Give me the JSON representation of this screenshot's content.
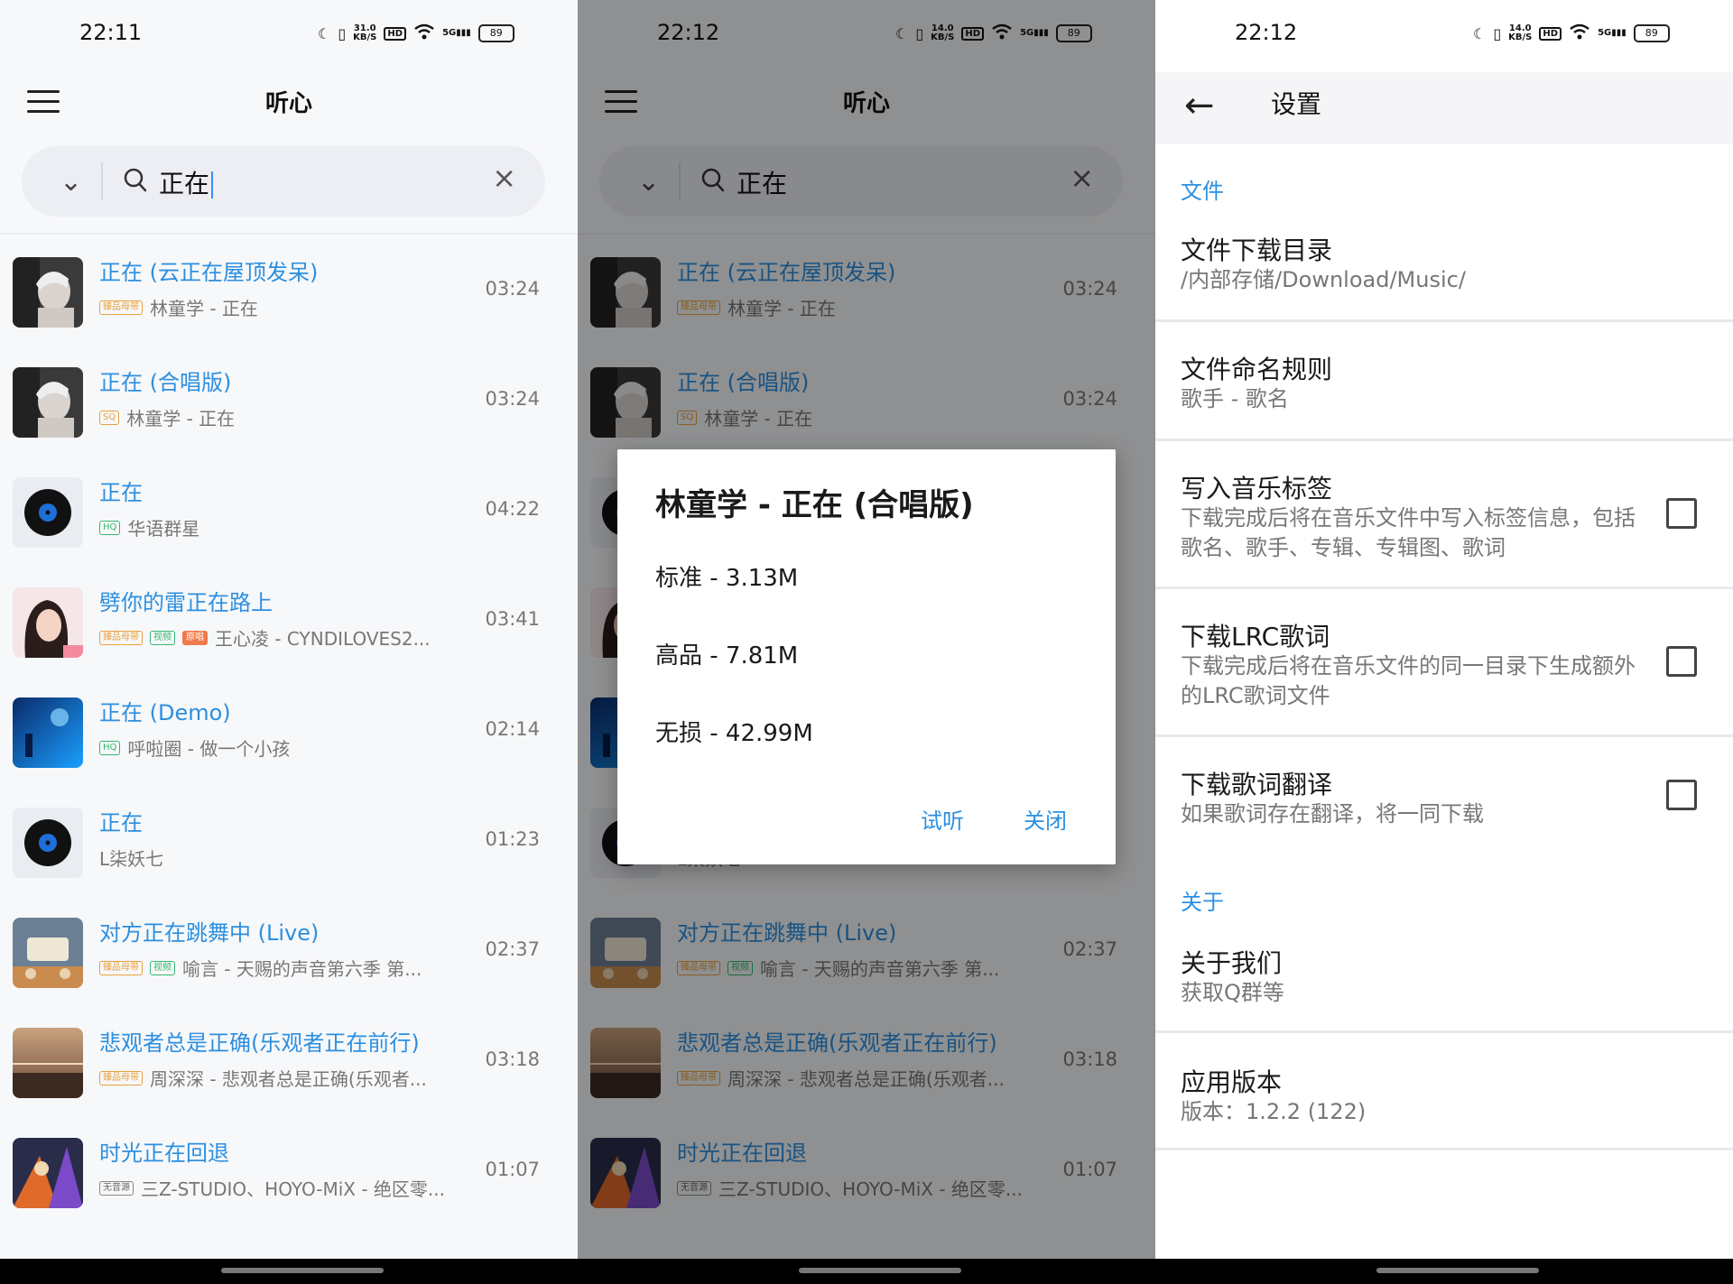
{
  "panel1": {
    "status": {
      "time": "22:11",
      "speed_num": "31.0",
      "speed_unit": "KB/S",
      "network": "5G",
      "battery": "89"
    },
    "app_title": "听心",
    "search": {
      "query": "正在"
    },
    "songs": [
      {
        "title": "正在 (云正在屋顶发呆)",
        "tags": [
          "臻品母带"
        ],
        "subtitle": "林童学 - 正在",
        "duration": "03:24",
        "cover": "photo-gray"
      },
      {
        "title": "正在 (合唱版)",
        "tags": [
          "SQ"
        ],
        "subtitle": "林童学 - 正在",
        "duration": "03:24",
        "cover": "photo-gray"
      },
      {
        "title": "正在",
        "tags": [
          "HQ"
        ],
        "subtitle": "华语群星",
        "duration": "04:22",
        "cover": "vinyl"
      },
      {
        "title": "劈你的雷正在路上",
        "tags": [
          "臻品母带",
          "视频",
          "原唱"
        ],
        "subtitle": "王心凌 - CYNDILOVES2...",
        "duration": "03:41",
        "cover": "portrait-pink"
      },
      {
        "title": "正在 (Demo)",
        "tags": [
          "HQ"
        ],
        "subtitle": "呼啦圈 - 做一个小孩",
        "duration": "02:14",
        "cover": "blue-stage"
      },
      {
        "title": "正在",
        "tags": [],
        "subtitle": "L柒妖七",
        "duration": "01:23",
        "cover": "vinyl"
      },
      {
        "title": "对方正在跳舞中 (Live)",
        "tags": [
          "臻品母带",
          "视频"
        ],
        "subtitle": "喻言 - 天赐的声音第六季 第...",
        "duration": "02:37",
        "cover": "show-poster"
      },
      {
        "title": "悲观者总是正确(乐观者正在前行)",
        "tags": [
          "臻品母带"
        ],
        "subtitle": "周深深 - 悲观者总是正确(乐观者...",
        "duration": "03:18",
        "cover": "sunset"
      },
      {
        "title": "时光正在回退",
        "tags": [
          "无音源"
        ],
        "subtitle": "三Z-STUDIO、HOYO-MiX - 绝区零...",
        "duration": "01:07",
        "cover": "game-art"
      }
    ]
  },
  "panel2": {
    "status": {
      "time": "22:12",
      "speed_num": "14.0",
      "speed_unit": "KB/S",
      "network": "5G",
      "battery": "89"
    },
    "app_title": "听心",
    "search": {
      "query": "正在"
    },
    "songs": [
      {
        "title": "正在 (云正在屋顶发呆)",
        "tags": [
          "臻品母带"
        ],
        "subtitle": "林童学 - 正在",
        "duration": "03:24",
        "cover": "photo-gray"
      },
      {
        "title": "正在 (合唱版)",
        "tags": [
          "SQ"
        ],
        "subtitle": "林童学 - 正在",
        "duration": "03:24",
        "cover": "photo-gray"
      },
      {
        "title": "",
        "tags": [],
        "subtitle": "",
        "duration": "",
        "cover": "vinyl"
      },
      {
        "title": "",
        "tags": [],
        "subtitle": "",
        "duration": "",
        "cover": "portrait-pink"
      },
      {
        "title": "",
        "tags": [],
        "subtitle": "",
        "duration": "",
        "cover": "blue-stage"
      },
      {
        "title": "",
        "tags": [],
        "subtitle": "L柒妖七",
        "duration": "",
        "cover": "vinyl"
      },
      {
        "title": "对方正在跳舞中 (Live)",
        "tags": [
          "臻品母带",
          "视频"
        ],
        "subtitle": "喻言 - 天赐的声音第六季 第...",
        "duration": "02:37",
        "cover": "show-poster"
      },
      {
        "title": "悲观者总是正确(乐观者正在前行)",
        "tags": [
          "臻品母带"
        ],
        "subtitle": "周深深 - 悲观者总是正确(乐观者...",
        "duration": "03:18",
        "cover": "sunset"
      },
      {
        "title": "时光正在回退",
        "tags": [
          "无音源"
        ],
        "subtitle": "三Z-STUDIO、HOYO-MiX - 绝区零...",
        "duration": "01:07",
        "cover": "game-art"
      }
    ],
    "dialog": {
      "title": "林童学 - 正在 (合唱版)",
      "options": [
        "标准 - 3.13M",
        "高品 - 7.81M",
        "无损 - 42.99M"
      ],
      "preview_label": "试听",
      "close_label": "关闭"
    }
  },
  "panel3": {
    "status": {
      "time": "22:12",
      "speed_num": "14.0",
      "speed_unit": "KB/S",
      "network": "5G",
      "battery": "89"
    },
    "title": "设置",
    "sections": {
      "file": "文件",
      "about": "关于"
    },
    "items": {
      "download_dir": {
        "title": "文件下载目录",
        "subtitle": "/内部存储/Download/Music/"
      },
      "naming": {
        "title": "文件命名规则",
        "subtitle": "歌手 - 歌名"
      },
      "write_tags": {
        "title": "写入音乐标签",
        "subtitle": "下载完成后将在音乐文件中写入标签信息，包括歌名、歌手、专辑、专辑图、歌词",
        "checked": false
      },
      "lrc": {
        "title": "下载LRC歌词",
        "subtitle": "下载完成后将在音乐文件的同一目录下生成额外的LRC歌词文件",
        "checked": false
      },
      "translation": {
        "title": "下载歌词翻译",
        "subtitle": "如果歌词存在翻译，将一同下载",
        "checked": false
      },
      "about_us": {
        "title": "关于我们",
        "subtitle": "获取Q群等"
      },
      "version": {
        "title": "应用版本",
        "subtitle": "版本：1.2.2 (122)"
      }
    }
  },
  "colors": {
    "accent": "#2c8fe0",
    "tag_gold": "#e8a040",
    "tag_green": "#35b96e",
    "tag_orange": "#f07a4a"
  }
}
